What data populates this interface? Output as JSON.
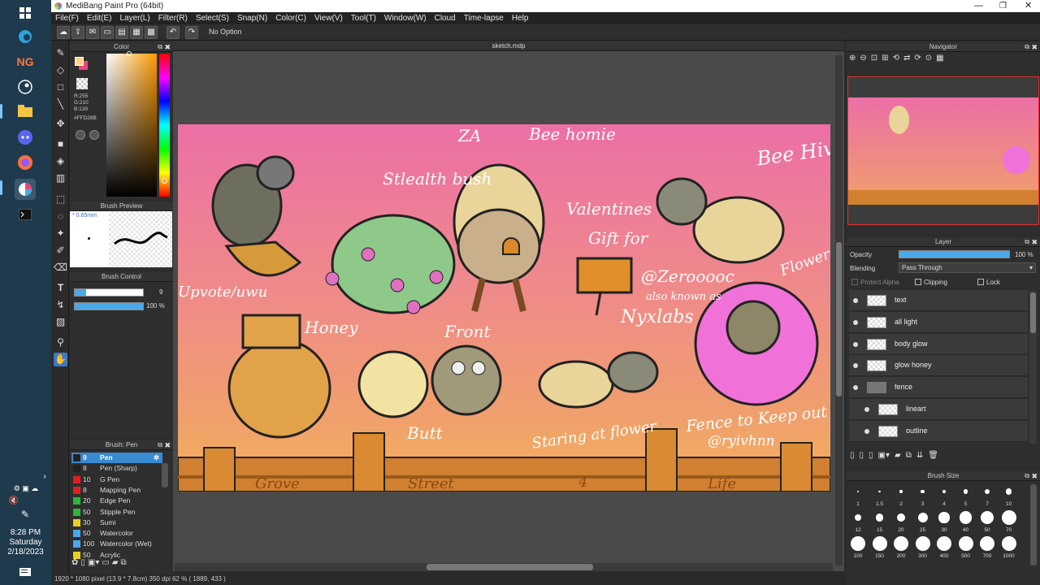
{
  "window": {
    "title": "MediBang Paint Pro (64bit)"
  },
  "menu": [
    "File(F)",
    "Edit(E)",
    "Layer(L)",
    "Filter(R)",
    "Select(S)",
    "Snap(N)",
    "Color(C)",
    "View(V)",
    "Tool(T)",
    "Window(W)",
    "Cloud",
    "Time-lapse",
    "Help"
  ],
  "toolbar": {
    "snap_label": "No Option"
  },
  "document_tab": "sketch.mdp",
  "color_panel": {
    "title": "Color",
    "r": "R:255",
    "g": "G:210",
    "b": "B:139",
    "hex": "#FFD28B",
    "primary": "#FFD28B",
    "secondary": "#e8457a"
  },
  "brush_preview": {
    "title": "Brush Preview",
    "size": "0.65mm"
  },
  "brush_control": {
    "title": "Brush Control",
    "size_value": "9",
    "opacity_value": "100 %"
  },
  "brush_list": {
    "title": "Brush: Pen",
    "items": [
      {
        "num": "9",
        "name": "Pen",
        "color": "#222222",
        "selected": true
      },
      {
        "num": "8",
        "name": "Pen (Sharp)",
        "color": "#222222"
      },
      {
        "num": "10",
        "name": "G Pen",
        "color": "#e02020"
      },
      {
        "num": "8",
        "name": "Mapping Pen",
        "color": "#e02020"
      },
      {
        "num": "20",
        "name": "Edge Pen",
        "color": "#2fb43a"
      },
      {
        "num": "50",
        "name": "Stipple Pen",
        "color": "#2fb43a"
      },
      {
        "num": "30",
        "name": "Sumi",
        "color": "#e8d020"
      },
      {
        "num": "50",
        "name": "Watercolor",
        "color": "#4aa8e8"
      },
      {
        "num": "100",
        "name": "Watercolor (Wet)",
        "color": "#4aa8e8"
      },
      {
        "num": "50",
        "name": "Acrylic",
        "color": "#e8d020"
      }
    ]
  },
  "artwork_labels": [
    "ZA",
    "Bee homie",
    "Stlealth bush",
    "Bee Hivee",
    "Valentines",
    "Gift for",
    "@Zerooooc",
    "also known as",
    "Nyxlabs",
    "Flower of Styx",
    "Upvote/uwu",
    "Honey",
    "Front",
    "Butt",
    "Staring at flower",
    "Fence to Keep out",
    "@ryivhnn",
    "Grove",
    "Street",
    "4",
    "Life"
  ],
  "status": "1920 * 1080 pixel  (13.9 * 7.8cm)  350 dpi  62 %  ( 1889, 433 )",
  "navigator": {
    "title": "Navigator"
  },
  "layer_panel": {
    "title": "Layer",
    "opacity_label": "Opacity",
    "opacity_value": "100 %",
    "blending_label": "Blending",
    "blending_value": "Pass Through",
    "protect_alpha": "Protect Alpha",
    "clipping": "Clipping",
    "lock": "Lock",
    "layers": [
      {
        "name": "text",
        "indent": false,
        "folder": false
      },
      {
        "name": "all light",
        "indent": false,
        "folder": false
      },
      {
        "name": "body glow",
        "indent": false,
        "folder": false
      },
      {
        "name": "glow honey",
        "indent": false,
        "folder": false
      },
      {
        "name": "fence",
        "indent": false,
        "folder": true
      },
      {
        "name": "lineart",
        "indent": true,
        "folder": false
      },
      {
        "name": "outline",
        "indent": true,
        "folder": false
      }
    ]
  },
  "brush_size": {
    "title": "Brush Size",
    "sizes": [
      "1",
      "1.5",
      "2",
      "3",
      "4",
      "5",
      "7",
      "10",
      "12",
      "15",
      "20",
      "25",
      "30",
      "40",
      "50",
      "70",
      "100",
      "150",
      "200",
      "300",
      "400",
      "500",
      "700",
      "1000"
    ]
  },
  "clock": {
    "time": "8:28 PM",
    "day": "Saturday",
    "date": "2/18/2023"
  }
}
